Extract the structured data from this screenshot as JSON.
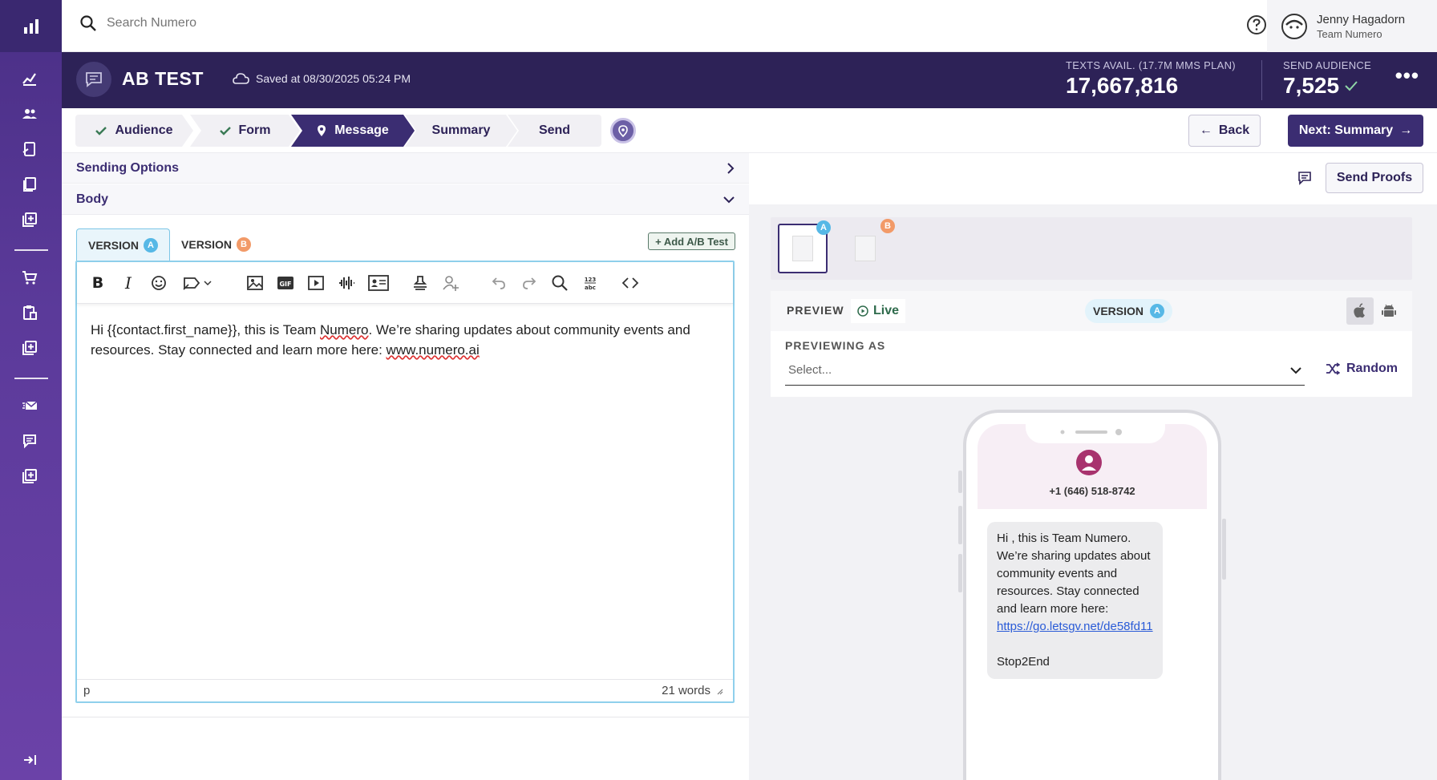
{
  "topbar": {
    "search_placeholder": "Search Numero",
    "user_name": "Jenny Hagadorn",
    "user_team": "Team Numero"
  },
  "header": {
    "title": "AB TEST",
    "saved_text": "Saved at 08/30/2025 05:24 PM",
    "texts_label": "TEXTS AVAIL. (17.7M MMS PLAN)",
    "texts_value": "17,667,816",
    "audience_label": "SEND AUDIENCE",
    "audience_value": "7,525",
    "more": "•••"
  },
  "steps": [
    {
      "label": "Audience",
      "state": "done"
    },
    {
      "label": "Form",
      "state": "done"
    },
    {
      "label": "Message",
      "state": "active"
    },
    {
      "label": "Summary",
      "state": "todo"
    },
    {
      "label": "Send",
      "state": "todo"
    }
  ],
  "nav": {
    "back_label": "Back",
    "next_label": "Next: Summary"
  },
  "sections": {
    "sending_options": "Sending Options",
    "body": "Body"
  },
  "versions": {
    "a_label": "VERSION",
    "a_badge": "A",
    "b_label": "VERSION",
    "b_badge": "B",
    "add_ab": "+ Add A/B Test"
  },
  "editor": {
    "content_1": "Hi {{contact.first_name}}, this is Team ",
    "content_numero": "Numero",
    "content_2": ". We’re sharing updates about community events and resources. Stay connected and learn more here: ",
    "content_link": "www.numero.ai",
    "status_tag": "p",
    "word_count": "21 words"
  },
  "right": {
    "send_proofs": "Send Proofs",
    "preview_label": "PREVIEW",
    "live_label": "Live",
    "version_label": "VERSION",
    "version_badge": "A",
    "previewing_as": "PREVIEWING AS",
    "select_placeholder": "Select...",
    "random_label": "Random",
    "thumb_a": "A",
    "thumb_b": "B"
  },
  "phone": {
    "number": "+1 (646) 518-8742",
    "message_text": "Hi , this is Team Numero. We’re sharing updates about community events and resources. Stay connected and learn more here:",
    "message_url": "https://go.letsgv.net/de58fd11",
    "message_footer": "Stop2End"
  },
  "colors": {
    "brand_dark": "#2d2257",
    "brand_primary": "#3b2d72",
    "version_a": "#56b8e6",
    "version_b": "#f29a68"
  }
}
